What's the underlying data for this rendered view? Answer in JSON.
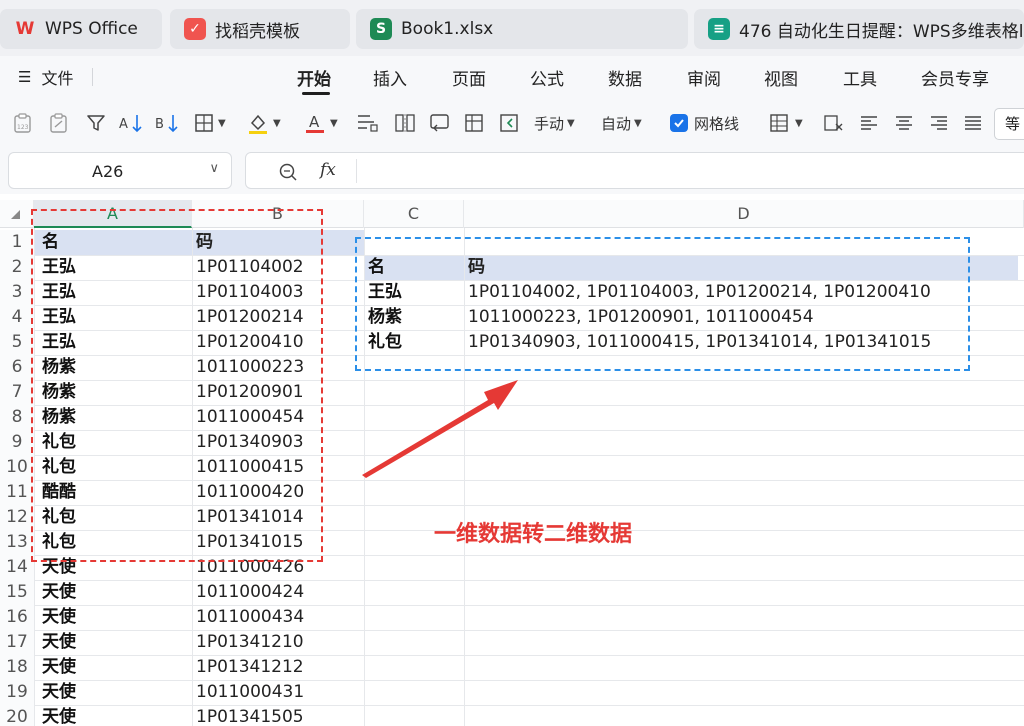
{
  "tabs": [
    {
      "label": "WPS Office",
      "icon": "wps-logo-icon",
      "color": "#e53935"
    },
    {
      "label": "找稻壳模板",
      "icon": "docer-logo-icon",
      "color": "#f0544f"
    },
    {
      "label": "Book1.xlsx",
      "icon": "spreadsheet-icon",
      "color": "#1e8a55"
    },
    {
      "label": "476 自动化生日提醒：WPS多维表格l",
      "icon": "multidim-table-icon",
      "color": "#16a085"
    }
  ],
  "menu": {
    "file_label": "文件",
    "tabs": [
      "开始",
      "插入",
      "页面",
      "公式",
      "数据",
      "审阅",
      "视图",
      "工具",
      "会员专享"
    ],
    "active": "开始"
  },
  "toolbar": {
    "manual_label": "手动",
    "auto_label": "自动",
    "gridlines_label": "网格线",
    "gridlines_checked": true,
    "style_label": "等"
  },
  "formula_bar": {
    "cell_ref": "A26",
    "fx_label": "fx",
    "formula": ""
  },
  "sheet": {
    "columns": [
      "A",
      "B",
      "C",
      "D"
    ],
    "row_numbers": [
      "1",
      "2",
      "3",
      "4",
      "5",
      "6",
      "7",
      "8",
      "9",
      "10",
      "11",
      "12",
      "13",
      "14",
      "15",
      "16",
      "17",
      "18",
      "19",
      "20"
    ],
    "source_header": {
      "name": "名",
      "code": "码"
    },
    "source_rows": [
      {
        "name": "王弘",
        "code": "1P01104002"
      },
      {
        "name": "王弘",
        "code": "1P01104003"
      },
      {
        "name": "王弘",
        "code": "1P01200214"
      },
      {
        "name": "王弘",
        "code": "1P01200410"
      },
      {
        "name": "杨紫",
        "code": "1011000223"
      },
      {
        "name": "杨紫",
        "code": "1P01200901"
      },
      {
        "name": "杨紫",
        "code": "1011000454"
      },
      {
        "name": "礼包",
        "code": "1P01340903"
      },
      {
        "name": "礼包",
        "code": "1011000415"
      },
      {
        "name": "酷酷",
        "code": "1011000420"
      },
      {
        "name": "礼包",
        "code": "1P01341014"
      },
      {
        "name": "礼包",
        "code": "1P01341015"
      },
      {
        "name": "天使",
        "code": "1011000426"
      },
      {
        "name": "天使",
        "code": "1011000424"
      },
      {
        "name": "天使",
        "code": "1011000434"
      },
      {
        "name": "天使",
        "code": "1P01341210"
      },
      {
        "name": "天使",
        "code": "1P01341212"
      },
      {
        "name": "天使",
        "code": "1011000431"
      },
      {
        "name": "天使",
        "code": "1P01341505"
      }
    ],
    "result_header": {
      "name": "名",
      "code": "码"
    },
    "result_rows": [
      {
        "name": "王弘",
        "codes": "1P01104002, 1P01104003, 1P01200214, 1P01200410"
      },
      {
        "name": "杨紫",
        "codes": "1011000223, 1P01200901, 1011000454"
      },
      {
        "name": "礼包",
        "codes": "1P01340903, 1011000415, 1P01341014, 1P01341015"
      }
    ]
  },
  "annotation": {
    "caption": "一维数据转二维数据",
    "red_color": "#e53935",
    "blue_color": "#2b8fe8"
  }
}
